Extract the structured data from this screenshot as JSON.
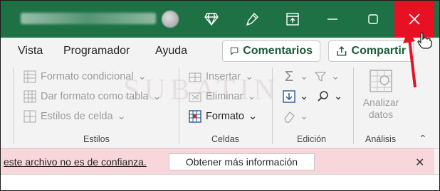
{
  "titlebar": {
    "close_label": "✕",
    "colors": {
      "bg": "#1e7145",
      "close_bg": "#e81123"
    }
  },
  "menu": {
    "items": [
      "Vista",
      "Programador",
      "Ayuda"
    ],
    "comments_label": "Comentarios",
    "share_label": "Compartir"
  },
  "ribbon": {
    "styles": {
      "conditional": "Formato condicional",
      "as_table": "Dar formato como tabla",
      "cell_styles": "Estilos de celda",
      "label": "Estilos"
    },
    "cells": {
      "insert": "Insertar",
      "delete": "Eliminar",
      "format": "Formato",
      "label": "Celdas"
    },
    "editing": {
      "label": "Edición"
    },
    "analysis": {
      "line1": "Analizar",
      "line2": "datos",
      "label": "Análisis"
    }
  },
  "notification": {
    "message": "este archivo no es de confianza.",
    "button": "Obtener más información",
    "close": "✕"
  },
  "watermark": "SUBATIN"
}
